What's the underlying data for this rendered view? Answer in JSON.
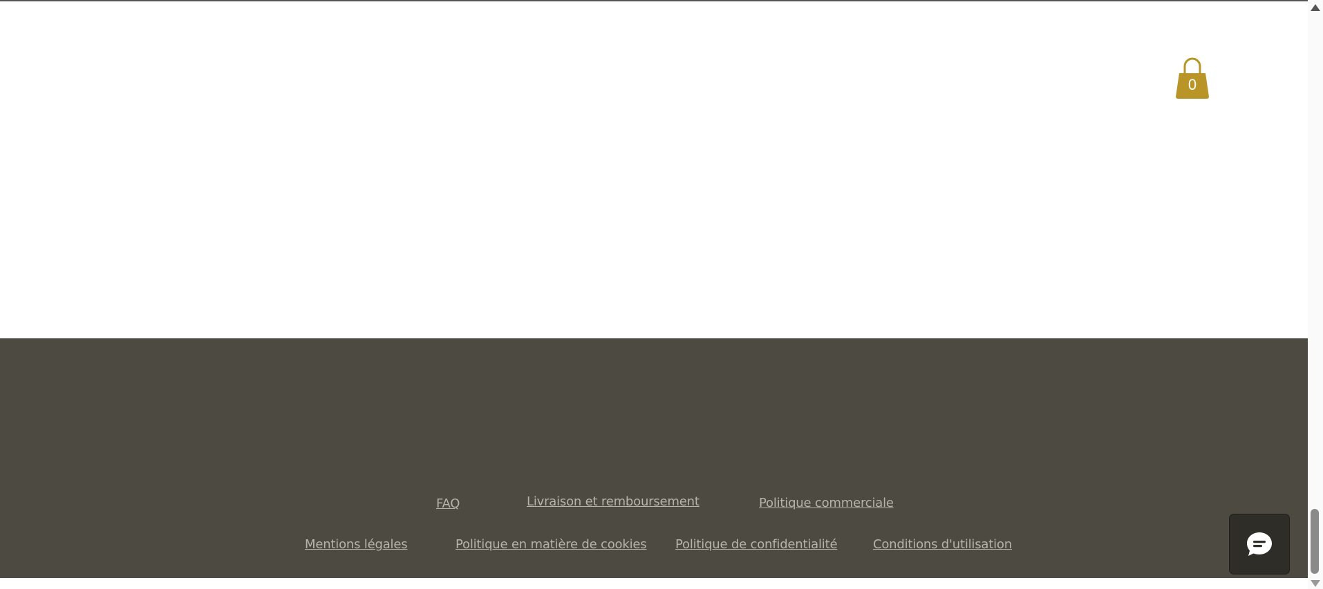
{
  "cart": {
    "count": "0",
    "icon": "shopping-bag-icon",
    "color": "#b99528"
  },
  "footer": {
    "background": "#4d4a42",
    "link_color": "#b8b3a8",
    "row1": [
      {
        "label": "FAQ"
      },
      {
        "label": "Livraison et remboursement"
      },
      {
        "label": "Politique commerciale"
      }
    ],
    "row2": [
      {
        "label": "Mentions légales"
      },
      {
        "label": "Politique en matière de cookies "
      },
      {
        "label": "Politique de confidentialité"
      },
      {
        "label": "Conditions d'utilisation"
      }
    ]
  },
  "chat": {
    "icon": "chat-bubble-icon"
  }
}
